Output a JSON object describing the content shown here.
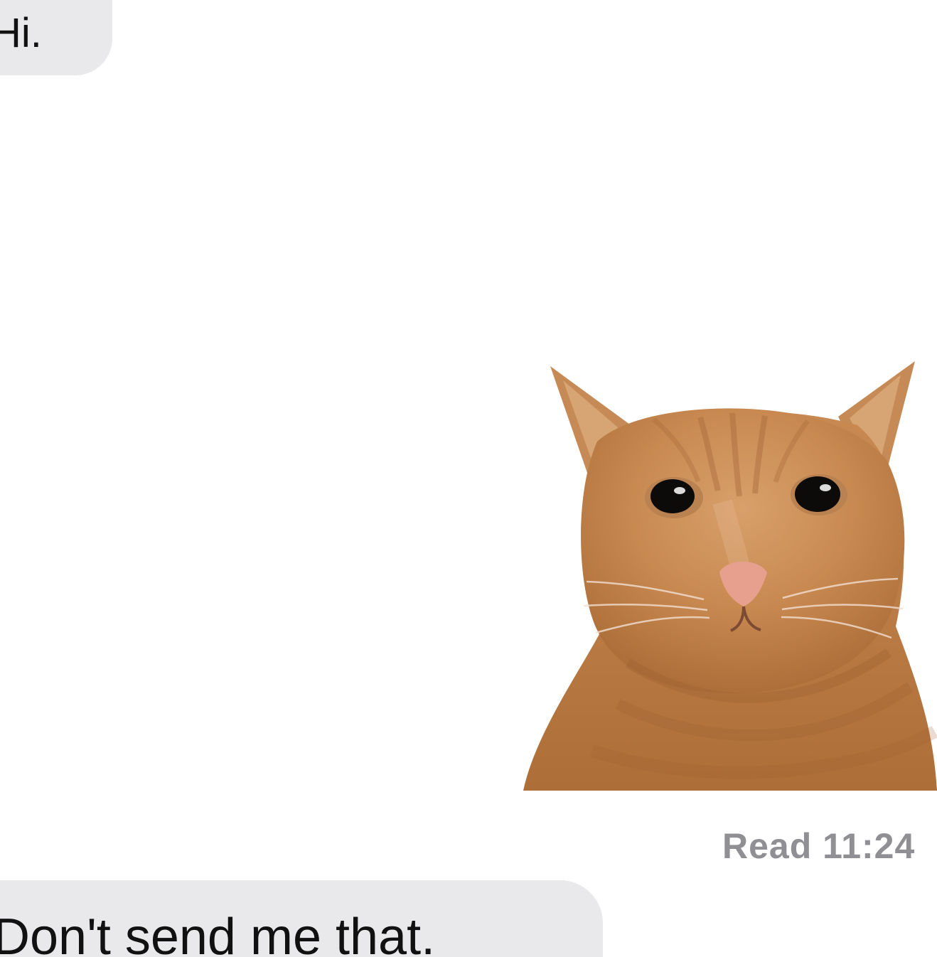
{
  "conversation": {
    "messages": [
      {
        "text": "Hi.",
        "sender": "other"
      },
      {
        "text": "Don't send me that.",
        "sender": "other"
      }
    ],
    "attachment": {
      "icon_name": "orange-cat-image"
    },
    "receipt": {
      "text": "Read 11:24"
    }
  },
  "colors": {
    "bubble_gray": "#e9e9eb",
    "background": "#ffffff",
    "receipt_text": "#8f8f94",
    "cat_orange": "#c98a52"
  }
}
